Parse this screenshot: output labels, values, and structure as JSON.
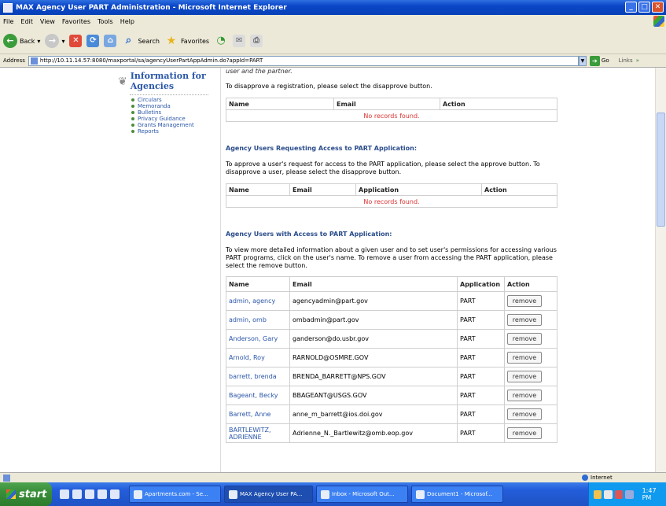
{
  "window": {
    "title": "MAX Agency User PART Administration - Microsoft Internet Explorer"
  },
  "menu": [
    "File",
    "Edit",
    "View",
    "Favorites",
    "Tools",
    "Help"
  ],
  "toolbar": {
    "back": "Back",
    "search": "Search",
    "favorites": "Favorites"
  },
  "address": {
    "label": "Address",
    "url": "http://10.11.14.57:8080/maxportal/sa/agencyUserPartAppAdmin.do?appId=PART",
    "go": "Go",
    "links": "Links"
  },
  "sidebar": {
    "heading_line1": "Information for",
    "heading_line2": "Agencies",
    "links": [
      "Circulars",
      "Memoranda",
      "Bulletins",
      "Privacy Guidance",
      "Grants Management",
      "Reports"
    ]
  },
  "main": {
    "cut_text": "user and the partner.",
    "disapprove_text": "To disapprove a registration, please select the disapprove button.",
    "reg_table": {
      "headers": [
        "Name",
        "Email",
        "Action"
      ],
      "empty": "No records found."
    },
    "requesting_heading": "Agency Users Requesting Access to PART Application:",
    "requesting_text": "To approve a user's request for access to the PART application, please select the approve button. To disapprove a user, please select the disapprove button.",
    "req_table": {
      "headers": [
        "Name",
        "Email",
        "Application",
        "Action"
      ],
      "empty": "No records found."
    },
    "access_heading": "Agency Users with Access to PART Application:",
    "access_text": "To view more detailed information about a given user and to set user's permissions for accessing various PART programs, click on the user's name. To remove a user from accessing the PART application, please select the remove button.",
    "users_table": {
      "headers": [
        "Name",
        "Email",
        "Application",
        "Action"
      ],
      "action_label": "remove",
      "rows": [
        {
          "name": "admin, agency",
          "email": "agencyadmin@part.gov",
          "app": "PART"
        },
        {
          "name": "admin, omb",
          "email": "ombadmin@part.gov",
          "app": "PART"
        },
        {
          "name": "Anderson, Gary",
          "email": "ganderson@do.usbr.gov",
          "app": "PART"
        },
        {
          "name": "Arnold, Roy",
          "email": "RARNOLD@OSMRE.GOV",
          "app": "PART"
        },
        {
          "name": "barrett, brenda",
          "email": "BRENDA_BARRETT@NPS.GOV",
          "app": "PART"
        },
        {
          "name": "Bageant, Becky",
          "email": "BBAGEANT@USGS.GOV",
          "app": "PART"
        },
        {
          "name": "Barrett, Anne",
          "email": "anne_m_barrett@ios.doi.gov",
          "app": "PART"
        },
        {
          "name": "BARTLEWITZ, ADRIENNE",
          "email": "Adrienne_N._Bartlewitz@omb.eop.gov",
          "app": "PART"
        }
      ]
    }
  },
  "status": {
    "zone": "Internet"
  },
  "taskbar": {
    "start": "start",
    "tasks": [
      "Apartments.com - Se...",
      "MAX Agency User PA...",
      "Inbox - Microsoft Out...",
      "Document1 - Microsof..."
    ],
    "clock": "1:47 PM"
  }
}
